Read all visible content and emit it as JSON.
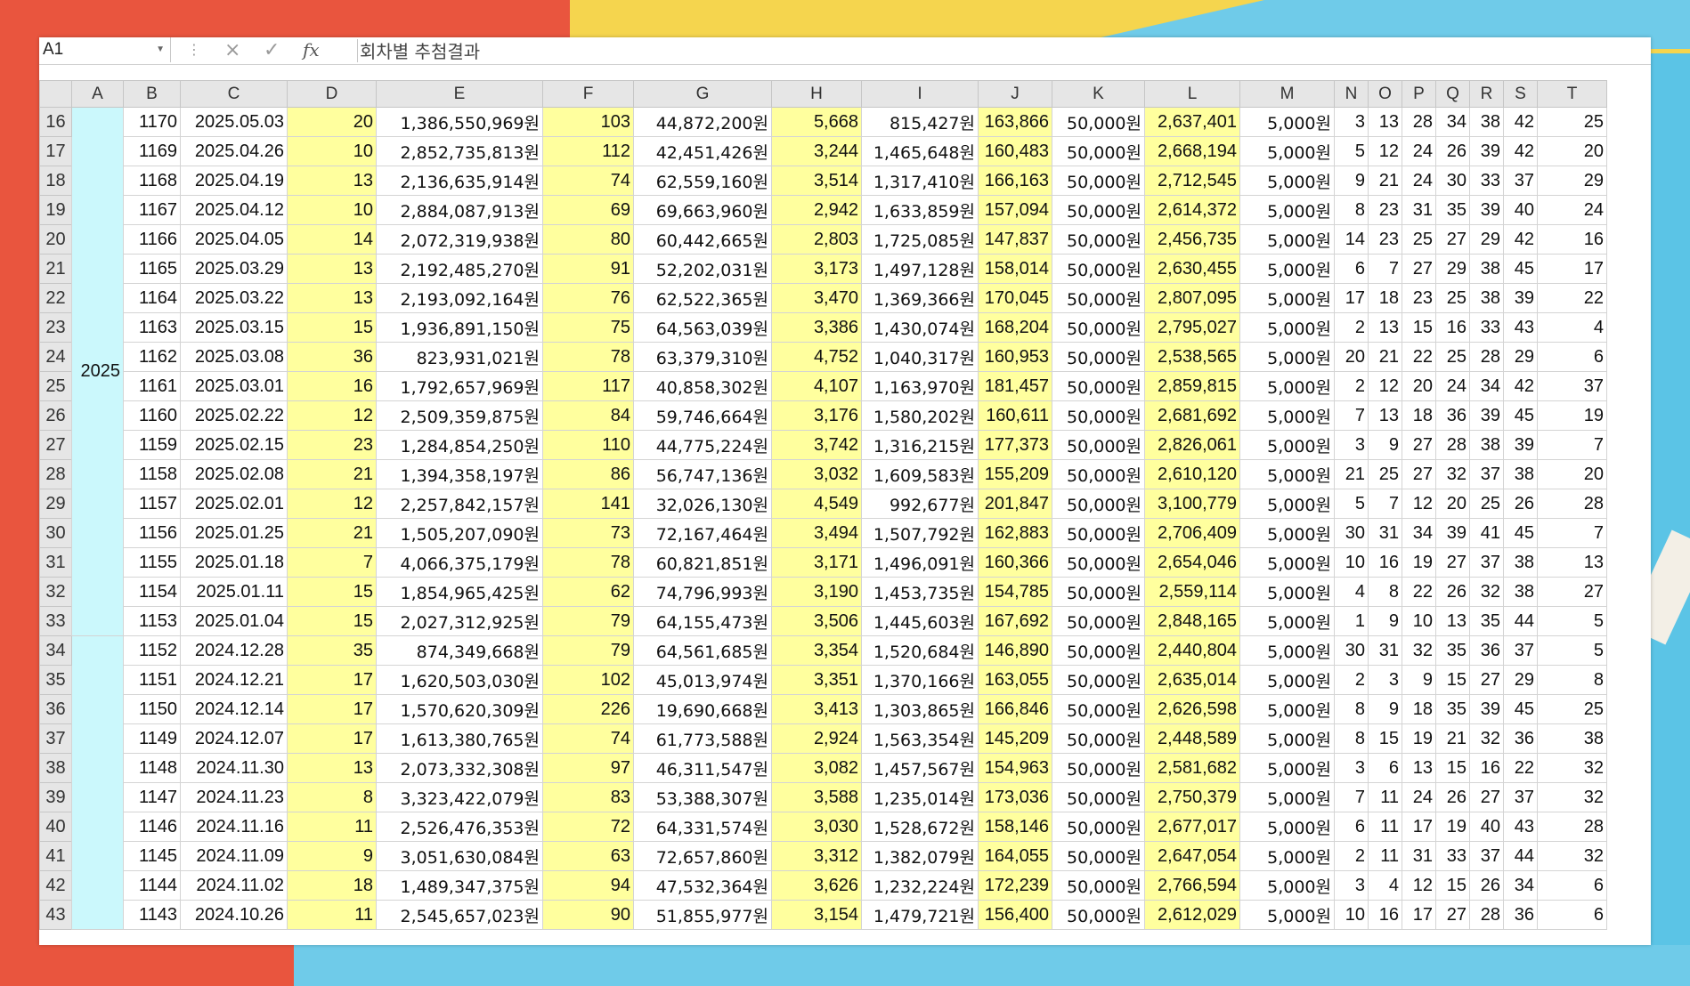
{
  "formula_bar": {
    "name_box": "A1",
    "cancel_icon": "×",
    "enter_icon": "✓",
    "fx_label": "fx",
    "formula": "회차별 추첨결과"
  },
  "columns": [
    "A",
    "B",
    "C",
    "D",
    "E",
    "F",
    "G",
    "H",
    "I",
    "J",
    "K",
    "L",
    "M",
    "N",
    "O",
    "P",
    "Q",
    "R",
    "S",
    "T"
  ],
  "year_groups": [
    {
      "label": "2025"
    },
    {
      "label": ""
    }
  ],
  "rows": [
    {
      "n": "16",
      "b": "1170",
      "c": "2025.05.03",
      "d": "20",
      "e": "1,386,550,969원",
      "f": "103",
      "g": "44,872,200원",
      "h": "5,668",
      "i": "815,427원",
      "j": "163,866",
      "k": "50,000원",
      "l": "2,637,401",
      "m": "5,000원",
      "nums": [
        "3",
        "13",
        "28",
        "34",
        "38",
        "42",
        "25"
      ]
    },
    {
      "n": "17",
      "b": "1169",
      "c": "2025.04.26",
      "d": "10",
      "e": "2,852,735,813원",
      "f": "112",
      "g": "42,451,426원",
      "h": "3,244",
      "i": "1,465,648원",
      "j": "160,483",
      "k": "50,000원",
      "l": "2,668,194",
      "m": "5,000원",
      "nums": [
        "5",
        "12",
        "24",
        "26",
        "39",
        "42",
        "20"
      ]
    },
    {
      "n": "18",
      "b": "1168",
      "c": "2025.04.19",
      "d": "13",
      "e": "2,136,635,914원",
      "f": "74",
      "g": "62,559,160원",
      "h": "3,514",
      "i": "1,317,410원",
      "j": "166,163",
      "k": "50,000원",
      "l": "2,712,545",
      "m": "5,000원",
      "nums": [
        "9",
        "21",
        "24",
        "30",
        "33",
        "37",
        "29"
      ]
    },
    {
      "n": "19",
      "b": "1167",
      "c": "2025.04.12",
      "d": "10",
      "e": "2,884,087,913원",
      "f": "69",
      "g": "69,663,960원",
      "h": "2,942",
      "i": "1,633,859원",
      "j": "157,094",
      "k": "50,000원",
      "l": "2,614,372",
      "m": "5,000원",
      "nums": [
        "8",
        "23",
        "31",
        "35",
        "39",
        "40",
        "24"
      ]
    },
    {
      "n": "20",
      "b": "1166",
      "c": "2025.04.05",
      "d": "14",
      "e": "2,072,319,938원",
      "f": "80",
      "g": "60,442,665원",
      "h": "2,803",
      "i": "1,725,085원",
      "j": "147,837",
      "k": "50,000원",
      "l": "2,456,735",
      "m": "5,000원",
      "nums": [
        "14",
        "23",
        "25",
        "27",
        "29",
        "42",
        "16"
      ]
    },
    {
      "n": "21",
      "b": "1165",
      "c": "2025.03.29",
      "d": "13",
      "e": "2,192,485,270원",
      "f": "91",
      "g": "52,202,031원",
      "h": "3,173",
      "i": "1,497,128원",
      "j": "158,014",
      "k": "50,000원",
      "l": "2,630,455",
      "m": "5,000원",
      "nums": [
        "6",
        "7",
        "27",
        "29",
        "38",
        "45",
        "17"
      ]
    },
    {
      "n": "22",
      "b": "1164",
      "c": "2025.03.22",
      "d": "13",
      "e": "2,193,092,164원",
      "f": "76",
      "g": "62,522,365원",
      "h": "3,470",
      "i": "1,369,366원",
      "j": "170,045",
      "k": "50,000원",
      "l": "2,807,095",
      "m": "5,000원",
      "nums": [
        "17",
        "18",
        "23",
        "25",
        "38",
        "39",
        "22"
      ]
    },
    {
      "n": "23",
      "b": "1163",
      "c": "2025.03.15",
      "d": "15",
      "e": "1,936,891,150원",
      "f": "75",
      "g": "64,563,039원",
      "h": "3,386",
      "i": "1,430,074원",
      "j": "168,204",
      "k": "50,000원",
      "l": "2,795,027",
      "m": "5,000원",
      "nums": [
        "2",
        "13",
        "15",
        "16",
        "33",
        "43",
        "4"
      ]
    },
    {
      "n": "24",
      "b": "1162",
      "c": "2025.03.08",
      "d": "36",
      "e": "823,931,021원",
      "f": "78",
      "g": "63,379,310원",
      "h": "4,752",
      "i": "1,040,317원",
      "j": "160,953",
      "k": "50,000원",
      "l": "2,538,565",
      "m": "5,000원",
      "nums": [
        "20",
        "21",
        "22",
        "25",
        "28",
        "29",
        "6"
      ]
    },
    {
      "n": "25",
      "b": "1161",
      "c": "2025.03.01",
      "d": "16",
      "e": "1,792,657,969원",
      "f": "117",
      "g": "40,858,302원",
      "h": "4,107",
      "i": "1,163,970원",
      "j": "181,457",
      "k": "50,000원",
      "l": "2,859,815",
      "m": "5,000원",
      "nums": [
        "2",
        "12",
        "20",
        "24",
        "34",
        "42",
        "37"
      ]
    },
    {
      "n": "26",
      "b": "1160",
      "c": "2025.02.22",
      "d": "12",
      "e": "2,509,359,875원",
      "f": "84",
      "g": "59,746,664원",
      "h": "3,176",
      "i": "1,580,202원",
      "j": "160,611",
      "k": "50,000원",
      "l": "2,681,692",
      "m": "5,000원",
      "nums": [
        "7",
        "13",
        "18",
        "36",
        "39",
        "45",
        "19"
      ]
    },
    {
      "n": "27",
      "b": "1159",
      "c": "2025.02.15",
      "d": "23",
      "e": "1,284,854,250원",
      "f": "110",
      "g": "44,775,224원",
      "h": "3,742",
      "i": "1,316,215원",
      "j": "177,373",
      "k": "50,000원",
      "l": "2,826,061",
      "m": "5,000원",
      "nums": [
        "3",
        "9",
        "27",
        "28",
        "38",
        "39",
        "7"
      ]
    },
    {
      "n": "28",
      "b": "1158",
      "c": "2025.02.08",
      "d": "21",
      "e": "1,394,358,197원",
      "f": "86",
      "g": "56,747,136원",
      "h": "3,032",
      "i": "1,609,583원",
      "j": "155,209",
      "k": "50,000원",
      "l": "2,610,120",
      "m": "5,000원",
      "nums": [
        "21",
        "25",
        "27",
        "32",
        "37",
        "38",
        "20"
      ]
    },
    {
      "n": "29",
      "b": "1157",
      "c": "2025.02.01",
      "d": "12",
      "e": "2,257,842,157원",
      "f": "141",
      "g": "32,026,130원",
      "h": "4,549",
      "i": "992,677원",
      "j": "201,847",
      "k": "50,000원",
      "l": "3,100,779",
      "m": "5,000원",
      "nums": [
        "5",
        "7",
        "12",
        "20",
        "25",
        "26",
        "28"
      ]
    },
    {
      "n": "30",
      "b": "1156",
      "c": "2025.01.25",
      "d": "21",
      "e": "1,505,207,090원",
      "f": "73",
      "g": "72,167,464원",
      "h": "3,494",
      "i": "1,507,792원",
      "j": "162,883",
      "k": "50,000원",
      "l": "2,706,409",
      "m": "5,000원",
      "nums": [
        "30",
        "31",
        "34",
        "39",
        "41",
        "45",
        "7"
      ]
    },
    {
      "n": "31",
      "b": "1155",
      "c": "2025.01.18",
      "d": "7",
      "e": "4,066,375,179원",
      "f": "78",
      "g": "60,821,851원",
      "h": "3,171",
      "i": "1,496,091원",
      "j": "160,366",
      "k": "50,000원",
      "l": "2,654,046",
      "m": "5,000원",
      "nums": [
        "10",
        "16",
        "19",
        "27",
        "37",
        "38",
        "13"
      ]
    },
    {
      "n": "32",
      "b": "1154",
      "c": "2025.01.11",
      "d": "15",
      "e": "1,854,965,425원",
      "f": "62",
      "g": "74,796,993원",
      "h": "3,190",
      "i": "1,453,735원",
      "j": "154,785",
      "k": "50,000원",
      "l": "2,559,114",
      "m": "5,000원",
      "nums": [
        "4",
        "8",
        "22",
        "26",
        "32",
        "38",
        "27"
      ]
    },
    {
      "n": "33",
      "b": "1153",
      "c": "2025.01.04",
      "d": "15",
      "e": "2,027,312,925원",
      "f": "79",
      "g": "64,155,473원",
      "h": "3,506",
      "i": "1,445,603원",
      "j": "167,692",
      "k": "50,000원",
      "l": "2,848,165",
      "m": "5,000원",
      "nums": [
        "1",
        "9",
        "10",
        "13",
        "35",
        "44",
        "5"
      ]
    },
    {
      "n": "34",
      "b": "1152",
      "c": "2024.12.28",
      "d": "35",
      "e": "874,349,668원",
      "f": "79",
      "g": "64,561,685원",
      "h": "3,354",
      "i": "1,520,684원",
      "j": "146,890",
      "k": "50,000원",
      "l": "2,440,804",
      "m": "5,000원",
      "nums": [
        "30",
        "31",
        "32",
        "35",
        "36",
        "37",
        "5"
      ]
    },
    {
      "n": "35",
      "b": "1151",
      "c": "2024.12.21",
      "d": "17",
      "e": "1,620,503,030원",
      "f": "102",
      "g": "45,013,974원",
      "h": "3,351",
      "i": "1,370,166원",
      "j": "163,055",
      "k": "50,000원",
      "l": "2,635,014",
      "m": "5,000원",
      "nums": [
        "2",
        "3",
        "9",
        "15",
        "27",
        "29",
        "8"
      ]
    },
    {
      "n": "36",
      "b": "1150",
      "c": "2024.12.14",
      "d": "17",
      "e": "1,570,620,309원",
      "f": "226",
      "g": "19,690,668원",
      "h": "3,413",
      "i": "1,303,865원",
      "j": "166,846",
      "k": "50,000원",
      "l": "2,626,598",
      "m": "5,000원",
      "nums": [
        "8",
        "9",
        "18",
        "35",
        "39",
        "45",
        "25"
      ]
    },
    {
      "n": "37",
      "b": "1149",
      "c": "2024.12.07",
      "d": "17",
      "e": "1,613,380,765원",
      "f": "74",
      "g": "61,773,588원",
      "h": "2,924",
      "i": "1,563,354원",
      "j": "145,209",
      "k": "50,000원",
      "l": "2,448,589",
      "m": "5,000원",
      "nums": [
        "8",
        "15",
        "19",
        "21",
        "32",
        "36",
        "38"
      ]
    },
    {
      "n": "38",
      "b": "1148",
      "c": "2024.11.30",
      "d": "13",
      "e": "2,073,332,308원",
      "f": "97",
      "g": "46,311,547원",
      "h": "3,082",
      "i": "1,457,567원",
      "j": "154,963",
      "k": "50,000원",
      "l": "2,581,682",
      "m": "5,000원",
      "nums": [
        "3",
        "6",
        "13",
        "15",
        "16",
        "22",
        "32"
      ]
    },
    {
      "n": "39",
      "b": "1147",
      "c": "2024.11.23",
      "d": "8",
      "e": "3,323,422,079원",
      "f": "83",
      "g": "53,388,307원",
      "h": "3,588",
      "i": "1,235,014원",
      "j": "173,036",
      "k": "50,000원",
      "l": "2,750,379",
      "m": "5,000원",
      "nums": [
        "7",
        "11",
        "24",
        "26",
        "27",
        "37",
        "32"
      ]
    },
    {
      "n": "40",
      "b": "1146",
      "c": "2024.11.16",
      "d": "11",
      "e": "2,526,476,353원",
      "f": "72",
      "g": "64,331,574원",
      "h": "3,030",
      "i": "1,528,672원",
      "j": "158,146",
      "k": "50,000원",
      "l": "2,677,017",
      "m": "5,000원",
      "nums": [
        "6",
        "11",
        "17",
        "19",
        "40",
        "43",
        "28"
      ]
    },
    {
      "n": "41",
      "b": "1145",
      "c": "2024.11.09",
      "d": "9",
      "e": "3,051,630,084원",
      "f": "63",
      "g": "72,657,860원",
      "h": "3,312",
      "i": "1,382,079원",
      "j": "164,055",
      "k": "50,000원",
      "l": "2,647,054",
      "m": "5,000원",
      "nums": [
        "2",
        "11",
        "31",
        "33",
        "37",
        "44",
        "32"
      ]
    },
    {
      "n": "42",
      "b": "1144",
      "c": "2024.11.02",
      "d": "18",
      "e": "1,489,347,375원",
      "f": "94",
      "g": "47,532,364원",
      "h": "3,626",
      "i": "1,232,224원",
      "j": "172,239",
      "k": "50,000원",
      "l": "2,766,594",
      "m": "5,000원",
      "nums": [
        "3",
        "4",
        "12",
        "15",
        "26",
        "34",
        "6"
      ]
    },
    {
      "n": "43",
      "b": "1143",
      "c": "2024.10.26",
      "d": "11",
      "e": "2,545,657,023원",
      "f": "90",
      "g": "51,855,977원",
      "h": "3,154",
      "i": "1,479,721원",
      "j": "156,400",
      "k": "50,000원",
      "l": "2,612,029",
      "m": "5,000원",
      "nums": [
        "10",
        "16",
        "17",
        "27",
        "28",
        "36",
        "6"
      ]
    }
  ]
}
